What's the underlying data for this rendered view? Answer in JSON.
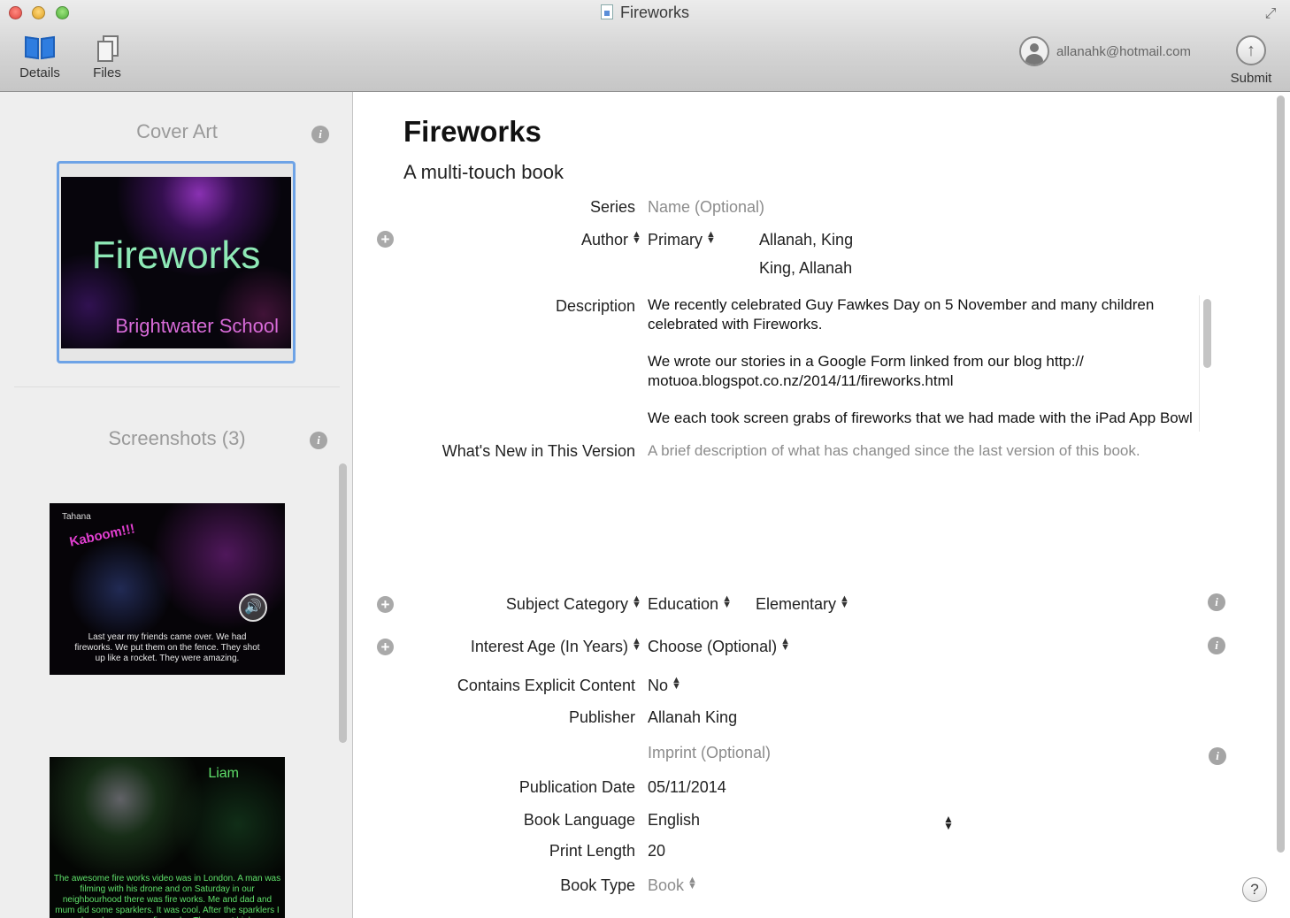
{
  "window": {
    "title": "Fireworks"
  },
  "toolbar": {
    "details_label": "Details",
    "files_label": "Files",
    "account_email": "allanahk@hotmail.com",
    "submit_label": "Submit"
  },
  "sidebar": {
    "cover_heading": "Cover Art",
    "cover_title": "Fireworks",
    "cover_subtitle": "Brightwater School",
    "screenshots_heading": "Screenshots (3)",
    "shot1": {
      "name": "Tahana",
      "kaboom": "Kaboom!!!",
      "caption": "Last year my friends came over. We had fireworks. We put them on the fence. They shot up like a rocket. They were amazing."
    },
    "shot2": {
      "name": "Liam",
      "caption": "The awesome fire works video was in London. A man was filming with his drone and on Saturday in our neighbourhood there was fire works. Me and dad and mum did some sparklers. It was cool. After the sparklers I heard some more fireworks. They went high"
    }
  },
  "book": {
    "title": "Fireworks",
    "subtitle": "A multi-touch book"
  },
  "form": {
    "series_label": "Series",
    "series_placeholder": "Name (Optional)",
    "author_label": "Author",
    "author_role": "Primary",
    "author_name_1": "Allanah, King",
    "author_name_2": "King, Allanah",
    "description_label": "Description",
    "description_p1": "We recently celebrated Guy Fawkes Day on 5 November and many children celebrated with Fireworks.",
    "description_p2": "We wrote our stories in a Google Form linked from our blog http:// motuoa.blogspot.co.nz/2014/11/fireworks.html",
    "description_p3": "We each took screen grabs of fireworks that we had made with the iPad App Bowl Fireworks",
    "whatsnew_label": "What's New in This Version",
    "whatsnew_placeholder": "A brief description of what has changed since the last version of this book.",
    "subject_label": "Subject Category",
    "subject_value": "Education",
    "subject_sub_value": "Elementary",
    "interest_label": "Interest Age (In Years)",
    "interest_value": "Choose (Optional)",
    "explicit_label": "Contains Explicit Content",
    "explicit_value": "No",
    "publisher_label": "Publisher",
    "publisher_value": "Allanah King",
    "imprint_placeholder": "Imprint (Optional)",
    "pubdate_label": "Publication Date",
    "pubdate_value": "05/11/2014",
    "language_label": "Book Language",
    "language_value": "English",
    "printlength_label": "Print Length",
    "printlength_value": "20",
    "booktype_label": "Book Type",
    "booktype_value": "Book"
  },
  "icons": {
    "details": "book-icon",
    "files": "documents-icon",
    "account": "user-avatar-icon",
    "submit": "upload-arrow-icon",
    "info": "info-icon",
    "add": "plus-circle-icon",
    "help": "help-icon"
  },
  "colors": {
    "accent": "#2f7de0",
    "selection_border": "#6ea3e6",
    "placeholder": "#8c8c8c"
  }
}
